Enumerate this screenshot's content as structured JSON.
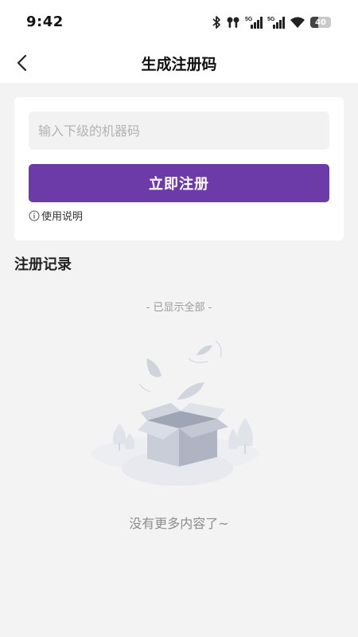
{
  "status_bar": {
    "time": "9:42",
    "battery_level": "40",
    "network_labels": [
      "5G",
      "5G"
    ],
    "icons": [
      "bluetooth-icon",
      "earbuds-icon",
      "signal-icon",
      "signal-icon",
      "wifi-icon",
      "battery-icon"
    ]
  },
  "header": {
    "title": "生成注册码",
    "back_icon": "chevron-left-icon"
  },
  "form": {
    "machine_code_placeholder": "输入下级的机器码",
    "machine_code_value": "",
    "register_button_label": "立即注册",
    "usage_icon": "info-circle-icon",
    "usage_link_label": "使用说明"
  },
  "records": {
    "section_title": "注册记录",
    "all_shown_text": "- 已显示全部 -",
    "empty_icon": "empty-box-icon",
    "empty_text": "没有更多内容了~"
  },
  "colors": {
    "accent": "#6c3ba8",
    "background": "#f3f3f3",
    "card": "#ffffff",
    "input_bg": "#f2f2f2"
  }
}
